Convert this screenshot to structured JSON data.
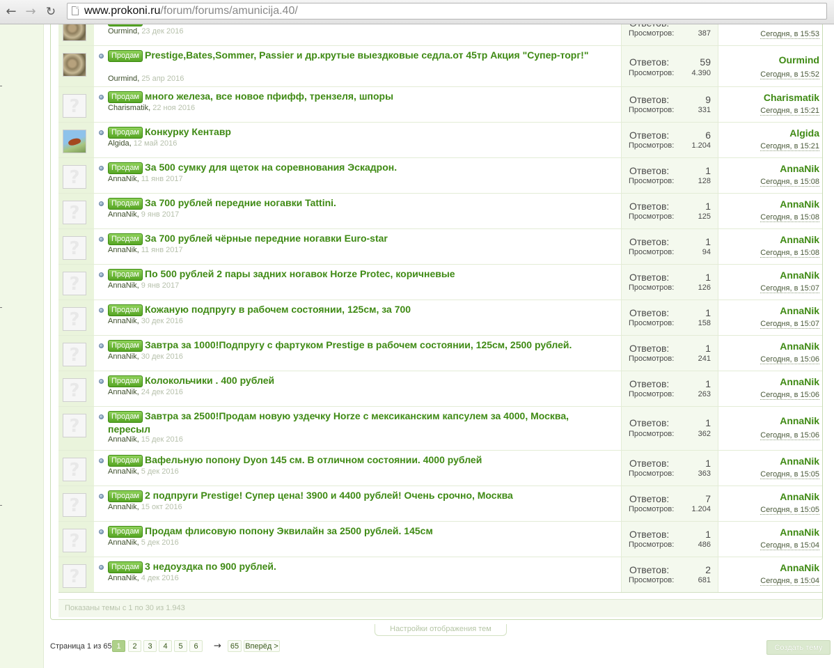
{
  "browser": {
    "url_host": "www.prokoni.ru",
    "url_path": "/forum/forums/amunicija.40/"
  },
  "labels": {
    "replies": "Ответов:",
    "views": "Просмотров:"
  },
  "threads": [
    {
      "prefix": "Продам",
      "title": "",
      "author": "Ourmind",
      "date": "23 дек 2016",
      "replies": "",
      "views": "387",
      "last_user": "",
      "last_time": "Сегодня, в 15:53",
      "avatar": "ourmind"
    },
    {
      "prefix": "Продам",
      "title": "Prestige,Bates,Sommer, Passier и др.крутые выездковые седла.от 45тр Акция \"Супер-торг!\"",
      "author": "Ourmind",
      "date": "25 апр 2016",
      "replies": "59",
      "views": "4.390",
      "last_user": "Ourmind",
      "last_time": "Сегодня, в 15:52",
      "avatar": "ourmind"
    },
    {
      "prefix": "Продам",
      "title": "много железа, все новое пфифф, трензеля, шпоры",
      "author": "Charismatik",
      "date": "22 ноя 2016",
      "replies": "9",
      "views": "331",
      "last_user": "Charismatik",
      "last_time": "Сегодня, в 15:21",
      "avatar": "default"
    },
    {
      "prefix": "Продам",
      "title": "Конкурку Кентавр",
      "author": "Algida",
      "date": "12 май 2016",
      "replies": "6",
      "views": "1.204",
      "last_user": "Algida",
      "last_time": "Сегодня, в 15:21",
      "avatar": "algida"
    },
    {
      "prefix": "Продам",
      "title": "За 500 сумку для щеток на соревнования Эскадрон.",
      "author": "AnnaNik",
      "date": "11 янв 2017",
      "replies": "1",
      "views": "128",
      "last_user": "AnnaNik",
      "last_time": "Сегодня, в 15:08",
      "avatar": "default"
    },
    {
      "prefix": "Продам",
      "title": "За 700 рублей передние ногавки Tattini.",
      "author": "AnnaNik",
      "date": "9 янв 2017",
      "replies": "1",
      "views": "125",
      "last_user": "AnnaNik",
      "last_time": "Сегодня, в 15:08",
      "avatar": "default"
    },
    {
      "prefix": "Продам",
      "title": "За 700 рублей чёрные передние ногавки Euro-star",
      "author": "AnnaNik",
      "date": "11 янв 2017",
      "replies": "1",
      "views": "94",
      "last_user": "AnnaNik",
      "last_time": "Сегодня, в 15:08",
      "avatar": "default"
    },
    {
      "prefix": "Продам",
      "title": "По 500 рублей 2 пары задних ногавок Horze Protec, коричневые",
      "author": "AnnaNik",
      "date": "9 янв 2017",
      "replies": "1",
      "views": "126",
      "last_user": "AnnaNik",
      "last_time": "Сегодня, в 15:07",
      "avatar": "default"
    },
    {
      "prefix": "Продам",
      "title": "Кожаную подпругу в рабочем состоянии, 125см, за 700",
      "author": "AnnaNik",
      "date": "30 дек 2016",
      "replies": "1",
      "views": "158",
      "last_user": "AnnaNik",
      "last_time": "Сегодня, в 15:07",
      "avatar": "default"
    },
    {
      "prefix": "Продам",
      "title": "Завтра за 1000!Подпругу с фартуком Prestige в рабочем состоянии, 125см, 2500 рублей.",
      "author": "AnnaNik",
      "date": "30 дек 2016",
      "replies": "1",
      "views": "241",
      "last_user": "AnnaNik",
      "last_time": "Сегодня, в 15:06",
      "avatar": "default"
    },
    {
      "prefix": "Продам",
      "title": "Колокольчики . 400 рублей",
      "author": "AnnaNik",
      "date": "24 дек 2016",
      "replies": "1",
      "views": "263",
      "last_user": "AnnaNik",
      "last_time": "Сегодня, в 15:06",
      "avatar": "default"
    },
    {
      "prefix": "Продам",
      "title": "Завтра за 2500!Продам новую уздечку Horze с мексиканским капсулем за 4000, Москва, пересыл",
      "author": "AnnaNik",
      "date": "15 дек 2016",
      "replies": "1",
      "views": "362",
      "last_user": "AnnaNik",
      "last_time": "Сегодня, в 15:06",
      "avatar": "default"
    },
    {
      "prefix": "Продам",
      "title": "Вафельную попону Dyon 145 см. В отличном состоянии. 4000 рублей",
      "author": "AnnaNik",
      "date": "5 дек 2016",
      "replies": "1",
      "views": "363",
      "last_user": "AnnaNik",
      "last_time": "Сегодня, в 15:05",
      "avatar": "default"
    },
    {
      "prefix": "Продам",
      "title": "2 подпруги Prestige! Супер цена! 3900 и 4400 рублей! Очень срочно, Москва",
      "author": "AnnaNik",
      "date": "15 окт 2016",
      "replies": "7",
      "views": "1.204",
      "last_user": "AnnaNik",
      "last_time": "Сегодня, в 15:05",
      "avatar": "default"
    },
    {
      "prefix": "Продам",
      "title": "Продам флисовую попону Эквилайн за 2500 рублей. 145см",
      "author": "AnnaNik",
      "date": "5 дек 2016",
      "replies": "1",
      "views": "486",
      "last_user": "AnnaNik",
      "last_time": "Сегодня, в 15:04",
      "avatar": "default"
    },
    {
      "prefix": "Продам",
      "title": "3 недоуздка по 900 рублей.",
      "author": "AnnaNik",
      "date": "4 дек 2016",
      "replies": "2",
      "views": "681",
      "last_user": "AnnaNik",
      "last_time": "Сегодня, в 15:04",
      "avatar": "default"
    }
  ],
  "footer": {
    "shown_text": "Показаны темы с 1 по 30 из 1.943",
    "display_settings": "Настройки отображения тем"
  },
  "pagination": {
    "label": "Страница 1 из 65",
    "pages": [
      "1",
      "2",
      "3",
      "4",
      "5",
      "6"
    ],
    "current": "1",
    "arrow": "→",
    "last_page": "65",
    "next": "Вперёд >"
  },
  "create_thread": "Создать тему",
  "colors": {
    "accent_green": "#3f8a14",
    "prefix_green": "#56a524",
    "panel_green": "#f1f8e7"
  }
}
